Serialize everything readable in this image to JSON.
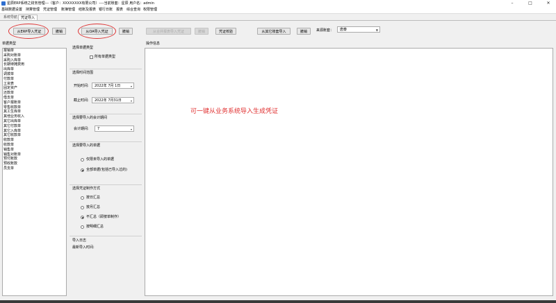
{
  "titlebar": {
    "title": "星辰ERP系统之财务管理---（客户：XXXXXXXX有限公司）----当前账套：星辰 用户名：admin",
    "minimize": "–",
    "maximize": "□",
    "close": "✕"
  },
  "menu": [
    "基础数据设置",
    "持算管理",
    "凭证管理",
    "账簿管理",
    "结账及报表",
    "银行日账",
    "报表",
    "综合查询",
    "权限管理"
  ],
  "tabs": [
    "系统导航",
    "凭证导入"
  ],
  "toolbar": {
    "from_erp": "从ERP导入凭证",
    "undo1": "撤销",
    "from_oa": "从OA导入凭证",
    "undo2": "撤销",
    "disabled1": "从合并报表导入凭证",
    "disabled2": "撤销",
    "voucher_check": "凭证校验",
    "from_other": "从其它账套导入",
    "undo3": "撤销",
    "source_label": "来源账套：",
    "source_value": "唐泰"
  },
  "left_list": {
    "header": "单据类型",
    "items": [
      "报销单",
      "采购对账单",
      "采购入库单",
      "长期待摊费用",
      "出库单",
      "调拨单",
      "付款单",
      "工资表",
      "固定资产",
      "还款单",
      "借支单",
      "客户报账单",
      "零售收款单",
      "其工生库单",
      "其他业务收入",
      "其它出库单",
      "其它付款单",
      "其它入库单",
      "其它收款单",
      "收款单",
      "收款单",
      "销售单",
      "销售对账单",
      "预付账款",
      "预收账款",
      "员支单"
    ]
  },
  "options": {
    "doc_type_title": "选择单据类型",
    "all_docs": "所有单据类型",
    "time_title": "选择时间范围",
    "start_label": "开始时间:",
    "start_value": "2022年 7月 1日",
    "end_label": "截止时间:",
    "end_value": "2022年 7月31日",
    "period_title": "选择要导入的会计期间",
    "period_label": "会计期间:",
    "period_value": "7",
    "doc_select_title": "选择要导入的单据",
    "only_new": "仅限未导入的单据",
    "all_incl": "全部单据(包括已导入过的)",
    "method_title": "选择凭证制作方式",
    "by_day": "按日汇总",
    "by_month": "按月汇总",
    "no_summary": "不汇总（即按单制作）",
    "by_detail": "按明细汇总",
    "log_title": "导入日志",
    "last_time": "最新导入时间:"
  },
  "log_panel": {
    "header": "操作信息"
  },
  "annotation": "可一键从业务系统导入生成凭证"
}
